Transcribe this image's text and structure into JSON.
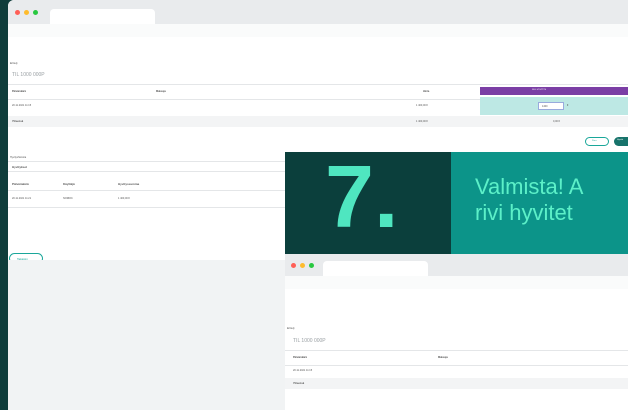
{
  "window1": {
    "colors": {
      "teal_header": "#7b3ea5",
      "teal_cell": "#bde8e4",
      "accent": "#1aa79a"
    },
    "section_label": "Erittely",
    "invoice_title": "TIL 1000 000P",
    "table": {
      "headers": [
        "Päivämäärä",
        "Maksaja",
        "Hinta",
        "SUL HYVITYS"
      ],
      "rows": [
        {
          "date": "20.11.2021 11:15",
          "amount": "1 400,00 €",
          "input_value": "1400",
          "unit": "€"
        },
        {
          "label": "Yhteensä",
          "amount": "1 400,00 €",
          "credit_total": "0,00 €"
        }
      ]
    },
    "cancel_label": "Peru",
    "confirm_label": "Hyvitä",
    "history": {
      "section_label": "Hyvityshistoria",
      "tab_label": "Hyvitykset",
      "headers": [
        "Päivämäärä",
        "Käyttäjä",
        "Hyvityssumma"
      ],
      "row": {
        "date": "20.11.2021 11:21",
        "user": "NORDIC",
        "amount": "1 400,00 €"
      }
    },
    "back_label": "Takaisin"
  },
  "banner": {
    "number": "7.",
    "line1": "Valmista! A",
    "line2": "rivi hyvitet"
  },
  "window2": {
    "section_label": "Erittely",
    "invoice_title": "TIL 1000 000P",
    "headers": [
      "Päivämäärä",
      "Maksaja"
    ],
    "rows": [
      {
        "date": "20.11.2021 11:15"
      },
      {
        "label": "Yhteensä"
      }
    ]
  }
}
